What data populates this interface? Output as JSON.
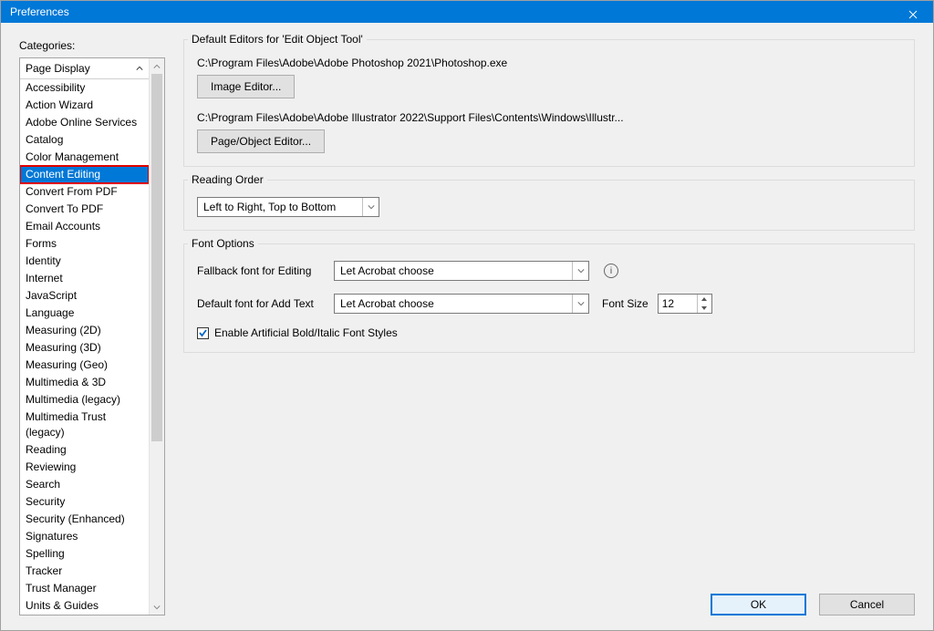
{
  "window": {
    "title": "Preferences"
  },
  "categories": {
    "label": "Categories:",
    "header": "Page Display",
    "items": [
      "Accessibility",
      "Action Wizard",
      "Adobe Online Services",
      "Catalog",
      "Color Management",
      "Content Editing",
      "Convert From PDF",
      "Convert To PDF",
      "Email Accounts",
      "Forms",
      "Identity",
      "Internet",
      "JavaScript",
      "Language",
      "Measuring (2D)",
      "Measuring (3D)",
      "Measuring (Geo)",
      "Multimedia & 3D",
      "Multimedia (legacy)",
      "Multimedia Trust (legacy)",
      "Reading",
      "Reviewing",
      "Search",
      "Security",
      "Security (Enhanced)",
      "Signatures",
      "Spelling",
      "Tracker",
      "Trust Manager",
      "Units & Guides"
    ],
    "selected_index": 5
  },
  "editors": {
    "legend": "Default Editors for 'Edit Object Tool'",
    "image_path": "C:\\Program Files\\Adobe\\Adobe Photoshop 2021\\Photoshop.exe",
    "image_btn": "Image Editor...",
    "page_path": "C:\\Program Files\\Adobe\\Adobe Illustrator 2022\\Support Files\\Contents\\Windows\\Illustr...",
    "page_btn": "Page/Object Editor..."
  },
  "reading_order": {
    "legend": "Reading Order",
    "value": "Left to Right, Top to Bottom"
  },
  "font_options": {
    "legend": "Font Options",
    "fallback_label": "Fallback font for Editing",
    "fallback_value": "Let Acrobat choose",
    "default_label": "Default font for Add Text",
    "default_value": "Let Acrobat choose",
    "font_size_label": "Font Size",
    "font_size_value": "12",
    "checkbox_label": "Enable Artificial Bold/Italic Font Styles",
    "checkbox_checked": true
  },
  "buttons": {
    "ok": "OK",
    "cancel": "Cancel"
  }
}
